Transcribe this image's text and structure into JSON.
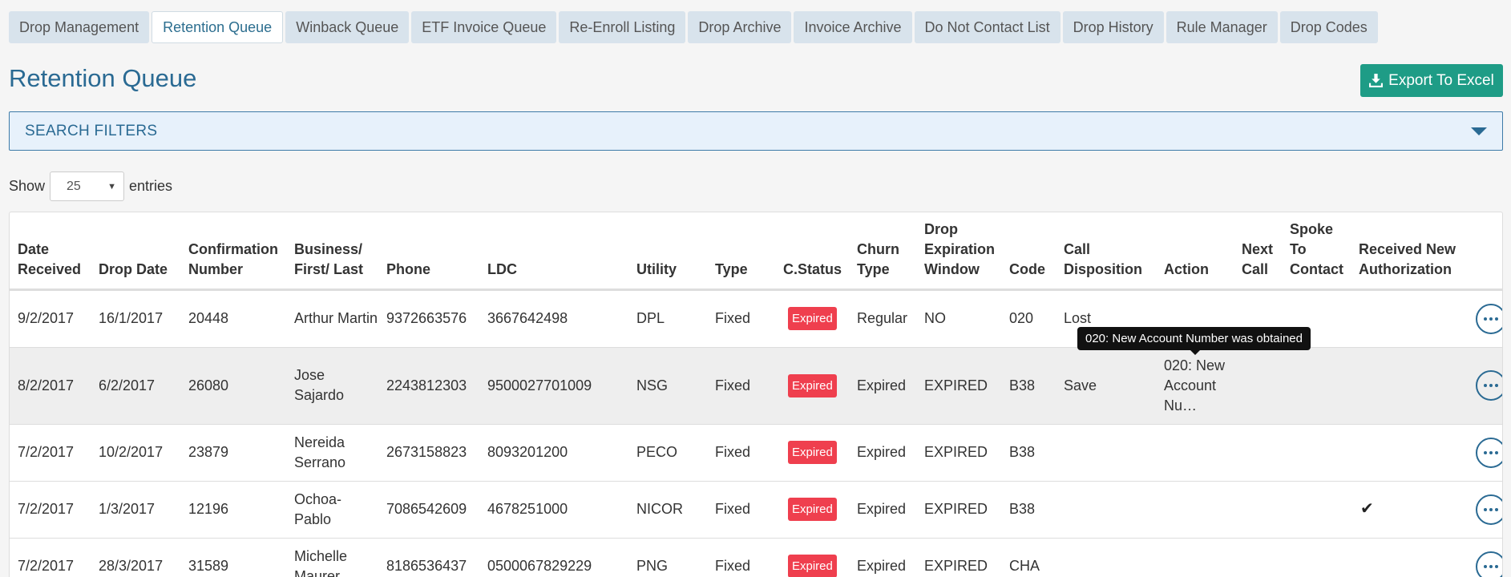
{
  "tabs": [
    {
      "label": "Drop Management"
    },
    {
      "label": "Retention Queue",
      "active": true
    },
    {
      "label": "Winback Queue"
    },
    {
      "label": "ETF Invoice Queue"
    },
    {
      "label": "Re-Enroll Listing"
    },
    {
      "label": "Drop Archive"
    },
    {
      "label": "Invoice Archive"
    },
    {
      "label": "Do Not Contact List"
    },
    {
      "label": "Drop History"
    },
    {
      "label": "Rule Manager"
    },
    {
      "label": "Drop Codes"
    }
  ],
  "page_title": "Retention Queue",
  "export_label": "Export To Excel",
  "filters_label": "SEARCH FILTERS",
  "show": {
    "prefix": "Show",
    "value": "25",
    "suffix": "entries"
  },
  "table": {
    "headers": [
      "Date Received",
      "Drop Date",
      "Confirmation Number",
      "Business/ First/ Last",
      "Phone",
      "LDC",
      "Utility",
      "Type",
      "C.Status",
      "Churn Type",
      "Drop Expiration Window",
      "Code",
      "Call Disposition",
      "Action",
      "Next Call",
      "Spoke To Contact",
      "Received New Authorization",
      ""
    ],
    "rows": [
      {
        "date_received": "9/2/2017",
        "drop_date": "16/1/2017",
        "confirmation": "20448",
        "name": "Arthur Martin",
        "phone": "9372663576",
        "ldc": "3667642498",
        "utility": "DPL",
        "type": "Fixed",
        "status": "Expired",
        "churn": "Regular",
        "window": "NO",
        "code": "020",
        "disposition": "Lost",
        "action": "",
        "next_call": "",
        "spoke": "",
        "received": ""
      },
      {
        "date_received": "8/2/2017",
        "drop_date": "6/2/2017",
        "confirmation": "26080",
        "name": "Jose Sajardo",
        "phone": "2243812303",
        "ldc": "9500027701009",
        "utility": "NSG",
        "type": "Fixed",
        "status": "Expired",
        "churn": "Expired",
        "window": "EXPIRED",
        "code": "B38",
        "disposition": "Save",
        "action": "020: New Account Nu…",
        "next_call": "",
        "spoke": "",
        "received": ""
      },
      {
        "date_received": "7/2/2017",
        "drop_date": "10/2/2017",
        "confirmation": "23879",
        "name": "Nereida Serrano",
        "phone": "2673158823",
        "ldc": "8093201200",
        "utility": "PECO",
        "type": "Fixed",
        "status": "Expired",
        "churn": "Expired",
        "window": "EXPIRED",
        "code": "B38",
        "disposition": "",
        "action": "",
        "next_call": "",
        "spoke": "",
        "received": ""
      },
      {
        "date_received": "7/2/2017",
        "drop_date": "1/3/2017",
        "confirmation": "12196",
        "name": "Ochoa-Pablo",
        "phone": "7086542609",
        "ldc": "4678251000",
        "utility": "NICOR",
        "type": "Fixed",
        "status": "Expired",
        "churn": "Expired",
        "window": "EXPIRED",
        "code": "B38",
        "disposition": "",
        "action": "",
        "next_call": "",
        "spoke": "",
        "received": "✔"
      },
      {
        "date_received": "7/2/2017",
        "drop_date": "28/3/2017",
        "confirmation": "31589",
        "name": "Michelle Maurer",
        "phone": "8186536437",
        "ldc": "0500067829229",
        "utility": "PNG",
        "type": "Fixed",
        "status": "Expired",
        "churn": "Expired",
        "window": "EXPIRED",
        "code": "CHA",
        "disposition": "",
        "action": "",
        "next_call": "",
        "spoke": "",
        "received": ""
      }
    ]
  },
  "tooltip": "020: New Account Number was obtained",
  "colors": {
    "accent": "#2a6a93",
    "export": "#1e9c86",
    "badge": "#ef3f4e"
  }
}
